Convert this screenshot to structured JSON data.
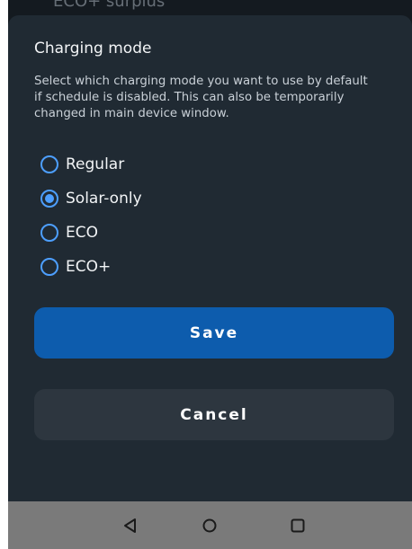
{
  "background_peek": {
    "text": "ECO+ surplus"
  },
  "dialog": {
    "title": "Charging mode",
    "description": "Select which charging mode you want to use by default if schedule is disabled. This can also be temporarily changed in main device window.",
    "options": [
      {
        "label": "Regular",
        "selected": false
      },
      {
        "label": "Solar-only",
        "selected": true
      },
      {
        "label": "ECO",
        "selected": false
      },
      {
        "label": "ECO+",
        "selected": false
      }
    ],
    "save_label": "Save",
    "cancel_label": "Cancel"
  },
  "colors": {
    "accent": "#4d9fff",
    "save_button": "#0d5cad",
    "cancel_button": "#2d363f",
    "sheet_background": "#202a33",
    "nav_bar": "#7a7a7a"
  },
  "navigation_bar": {
    "icons": [
      "back-triangle-icon",
      "home-circle-icon",
      "recents-square-icon"
    ]
  }
}
